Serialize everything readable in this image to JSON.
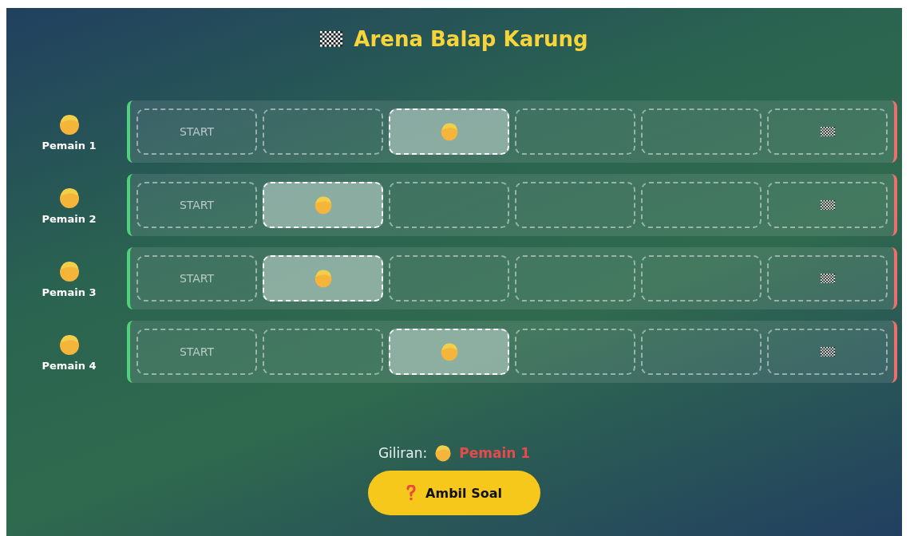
{
  "title": "Arena Balap Karung",
  "lanes": [
    {
      "player": "Pemain 1",
      "cells": [
        {
          "kind": "start",
          "label": "START",
          "occupied": false
        },
        {
          "kind": "track",
          "occupied": false
        },
        {
          "kind": "track",
          "occupied": true
        },
        {
          "kind": "track",
          "occupied": false
        },
        {
          "kind": "track",
          "occupied": false
        },
        {
          "kind": "finish",
          "occupied": false
        }
      ]
    },
    {
      "player": "Pemain 2",
      "cells": [
        {
          "kind": "start",
          "label": "START",
          "occupied": false
        },
        {
          "kind": "track",
          "occupied": true
        },
        {
          "kind": "track",
          "occupied": false
        },
        {
          "kind": "track",
          "occupied": false
        },
        {
          "kind": "track",
          "occupied": false
        },
        {
          "kind": "finish",
          "occupied": false
        }
      ]
    },
    {
      "player": "Pemain 3",
      "cells": [
        {
          "kind": "start",
          "label": "START",
          "occupied": false
        },
        {
          "kind": "track",
          "occupied": true
        },
        {
          "kind": "track",
          "occupied": false
        },
        {
          "kind": "track",
          "occupied": false
        },
        {
          "kind": "track",
          "occupied": false
        },
        {
          "kind": "finish",
          "occupied": false
        }
      ]
    },
    {
      "player": "Pemain 4",
      "cells": [
        {
          "kind": "start",
          "label": "START",
          "occupied": false
        },
        {
          "kind": "track",
          "occupied": false
        },
        {
          "kind": "track",
          "occupied": true
        },
        {
          "kind": "track",
          "occupied": false
        },
        {
          "kind": "track",
          "occupied": false
        },
        {
          "kind": "finish",
          "occupied": false
        }
      ]
    }
  ],
  "turn": {
    "label": "Giliran:",
    "player": "Pemain 1"
  },
  "button": "Ambil Soal"
}
